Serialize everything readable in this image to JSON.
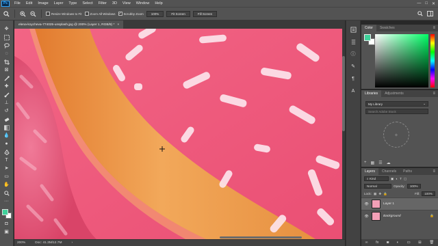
{
  "menu": {
    "logo": "Ps",
    "items": [
      "File",
      "Edit",
      "Image",
      "Layer",
      "Type",
      "Select",
      "Filter",
      "3D",
      "View",
      "Window",
      "Help"
    ],
    "window_controls": [
      "—",
      "□",
      "✕"
    ]
  },
  "options_bar": {
    "resize_windows": "Resize Windows to Fit",
    "resize_checked": false,
    "zoom_all": "Zoom All Windows",
    "zoom_all_checked": false,
    "scrubby_zoom": "Scrubby Zoom",
    "scrubby_checked": true,
    "btn_100": "100%",
    "btn_fit": "Fit Screen",
    "btn_fill": "Fill Screen"
  },
  "document": {
    "tab_title": "elena-koycheva-774025-unsplash.jpg @ 200% (Layer 1, RGB/8) *",
    "close": "×"
  },
  "status": {
    "zoom": "200%",
    "doc_info": "Doc: 41.3M/12.7M"
  },
  "color_panel": {
    "tabs": [
      "Color",
      "Swatches"
    ],
    "foreground": "#3fd19a",
    "background": "#ffffff"
  },
  "libraries_panel": {
    "tabs": [
      "Libraries",
      "Adjustments"
    ],
    "library_name": "My Library",
    "search_placeholder": "Search Adobe Stock"
  },
  "layers_panel": {
    "tabs": [
      "Layers",
      "Channels",
      "Paths"
    ],
    "kind_label": "Kind",
    "blend_mode": "Normal",
    "opacity_label": "Opacity:",
    "opacity": "100%",
    "lock_label": "Lock:",
    "fill_label": "Fill:",
    "fill": "100%",
    "layers": [
      {
        "name": "Layer 1",
        "selected": true
      },
      {
        "name": "Background",
        "selected": false
      }
    ]
  },
  "colors": {
    "icing": "#e94a6e",
    "dough": "#e8963d",
    "sprinkle": "#fbe3ea"
  }
}
